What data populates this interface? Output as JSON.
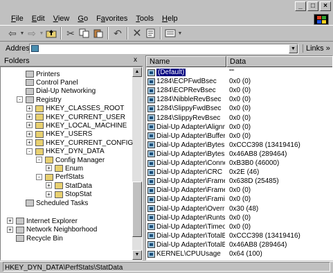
{
  "window": {
    "controls": [
      "_",
      "□",
      "×"
    ]
  },
  "menubar": {
    "items": [
      "File",
      "Edit",
      "View",
      "Go",
      "Favorites",
      "Tools",
      "Help"
    ],
    "accels": [
      "F",
      "E",
      "V",
      "G",
      "a",
      "T",
      "H"
    ]
  },
  "toolbar": {
    "back_icon": "back-arrow-icon",
    "forward_icon": "forward-arrow-icon",
    "up_icon": "up-folder-icon",
    "cut_icon": "scissors-icon",
    "copy_icon": "copy-icon",
    "paste_icon": "paste-icon",
    "undo_icon": "undo-icon",
    "delete_icon": "delete-x-icon",
    "properties_icon": "properties-icon",
    "views_icon": "views-icon"
  },
  "address": {
    "label": "Address",
    "value": "",
    "links_label": "Links »"
  },
  "folders": {
    "title": "Folders",
    "close_glyph": "x",
    "nodes": [
      {
        "label": "Printers",
        "indent": 1
      },
      {
        "label": "Control Panel",
        "indent": 1
      },
      {
        "label": "Dial-Up Networking",
        "indent": 1
      },
      {
        "label": "Registry",
        "indent": 1,
        "expander": "-"
      },
      {
        "label": "HKEY_CLASSES_ROOT",
        "indent": 2,
        "expander": "+"
      },
      {
        "label": "HKEY_CURRENT_USER",
        "indent": 2,
        "expander": "+"
      },
      {
        "label": "HKEY_LOCAL_MACHINE",
        "indent": 2,
        "expander": "+"
      },
      {
        "label": "HKEY_USERS",
        "indent": 2,
        "expander": "+"
      },
      {
        "label": "HKEY_CURRENT_CONFIG",
        "indent": 2,
        "expander": "+"
      },
      {
        "label": "HKEY_DYN_DATA",
        "indent": 2,
        "expander": "-"
      },
      {
        "label": "Config Manager",
        "indent": 3,
        "expander": "-"
      },
      {
        "label": "Enum",
        "indent": 4,
        "expander": "+"
      },
      {
        "label": "PerfStats",
        "indent": 3,
        "expander": "-"
      },
      {
        "label": "StatData",
        "indent": 4,
        "expander": "+"
      },
      {
        "label": "StopStat",
        "indent": 4,
        "expander": "+"
      },
      {
        "label": "Scheduled Tasks",
        "indent": 1
      },
      {
        "label": "Internet Explorer",
        "indent": 0,
        "expander": "+"
      },
      {
        "label": "Network Neighborhood",
        "indent": 0,
        "expander": "+"
      },
      {
        "label": "Recycle Bin",
        "indent": 0
      }
    ]
  },
  "list": {
    "col_name": "Name",
    "col_data": "Data",
    "rows": [
      {
        "name": "(Default)",
        "data": "\"\"",
        "selected": true
      },
      {
        "name": "1284\\ECPFwdBsec",
        "data": "0x0 (0)"
      },
      {
        "name": "1284\\ECPRevBsec",
        "data": "0x0 (0)"
      },
      {
        "name": "1284\\NibbleRevBsec",
        "data": "0x0 (0)"
      },
      {
        "name": "1284\\SlippyFwdBsec",
        "data": "0x0 (0)"
      },
      {
        "name": "1284\\SlippyRevBsec",
        "data": "0x0 (0)"
      },
      {
        "name": "Dial-Up Adapter\\Alignment",
        "data": "0x0 (0)"
      },
      {
        "name": "Dial-Up Adapter\\Buffer",
        "data": "0x0 (0)"
      },
      {
        "name": "Dial-Up Adapter\\BytesR...",
        "data": "0xCCC398 (13419416)"
      },
      {
        "name": "Dial-Up Adapter\\BytesXmit",
        "data": "0x46AB8 (289464)"
      },
      {
        "name": "Dial-Up Adapter\\Connec...",
        "data": "0xB3B0 (46000)"
      },
      {
        "name": "Dial-Up Adapter\\CRC",
        "data": "0x2E (46)"
      },
      {
        "name": "Dial-Up Adapter\\Frames...",
        "data": "0x638D (25485)"
      },
      {
        "name": "Dial-Up Adapter\\Frames...",
        "data": "0x0 (0)"
      },
      {
        "name": "Dial-Up Adapter\\Framing",
        "data": "0x0 (0)"
      },
      {
        "name": "Dial-Up Adapter\\Overrun",
        "data": "0x30 (48)"
      },
      {
        "name": "Dial-Up Adapter\\Runts",
        "data": "0x0 (0)"
      },
      {
        "name": "Dial-Up Adapter\\Timeout",
        "data": "0x0 (0)"
      },
      {
        "name": "Dial-Up Adapter\\TotalByt...",
        "data": "0xCCC398 (13419416)"
      },
      {
        "name": "Dial-Up Adapter\\TotalByt...",
        "data": "0x46AB8 (289464)"
      },
      {
        "name": "KERNEL\\CPUUsage",
        "data": "0x64 (100)"
      }
    ]
  },
  "status": {
    "text": "HKEY_DYN_DATA\\PerfStats\\StatData"
  },
  "colors": {
    "chrome": "#c0c0c0",
    "selection": "#000080"
  }
}
